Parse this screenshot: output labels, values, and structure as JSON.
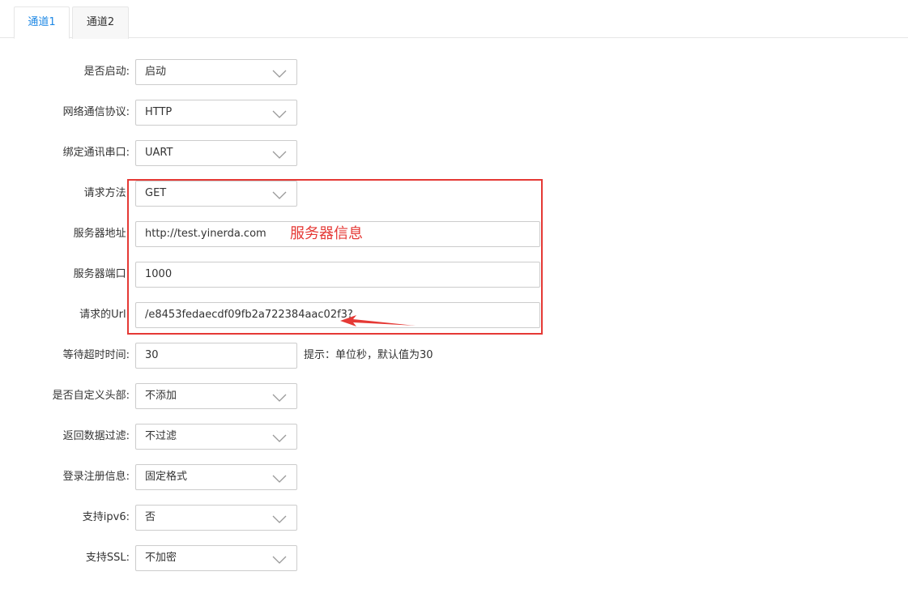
{
  "tabs": [
    {
      "label": "通道1",
      "active": true
    },
    {
      "label": "通道2",
      "active": false
    }
  ],
  "form": {
    "enabled": {
      "label": "是否启动:",
      "value": "启动"
    },
    "protocol": {
      "label": "网络通信协议:",
      "value": "HTTP"
    },
    "serial_port": {
      "label": "绑定通讯串口:",
      "value": "UART"
    },
    "method": {
      "label": "请求方法:",
      "value": "GET"
    },
    "server_address": {
      "label": "服务器地址:",
      "value": "http://test.yinerda.com"
    },
    "server_port": {
      "label": "服务器端口:",
      "value": "1000"
    },
    "request_url": {
      "label": "请求的Url:",
      "value": "/e8453fedaecdf09fb2a722384aac02f3?"
    },
    "timeout": {
      "label": "等待超时时间:",
      "value": "30",
      "hint": "提示：单位秒，默认值为30"
    },
    "custom_header": {
      "label": "是否自定义头部:",
      "value": "不添加"
    },
    "data_filter": {
      "label": "返回数据过滤:",
      "value": "不过滤"
    },
    "login_info": {
      "label": "登录注册信息:",
      "value": "固定格式"
    },
    "ipv6": {
      "label": "支持ipv6:",
      "value": "否"
    },
    "ssl": {
      "label": "支持SSL:",
      "value": "不加密"
    }
  },
  "annotation": {
    "text": "服务器信息",
    "color": "#e53935"
  },
  "colors": {
    "accent": "#1e88e5",
    "border": "#cccccc",
    "annotation_red": "#e53935"
  }
}
